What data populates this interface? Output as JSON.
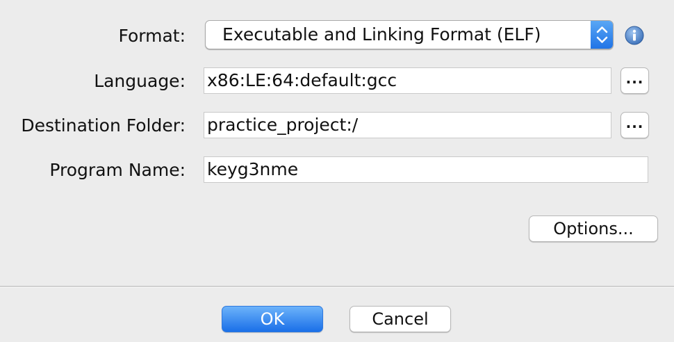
{
  "form": {
    "format": {
      "label": "Format:",
      "value": "Executable and Linking Format (ELF)"
    },
    "language": {
      "label": "Language:",
      "value": "x86:LE:64:default:gcc",
      "browse_label": "..."
    },
    "destination": {
      "label": "Destination Folder:",
      "value": "practice_project:/",
      "browse_label": "..."
    },
    "program_name": {
      "label": "Program Name:",
      "value": "keyg3nme"
    },
    "options_label": "Options..."
  },
  "footer": {
    "ok_label": "OK",
    "cancel_label": "Cancel"
  },
  "icons": {
    "info": "info-icon",
    "select_arrows": "up-down-chevron-icon"
  },
  "colors": {
    "background": "#ececec",
    "accent": "#1f73e6",
    "info_icon": "#4a7fc4"
  }
}
